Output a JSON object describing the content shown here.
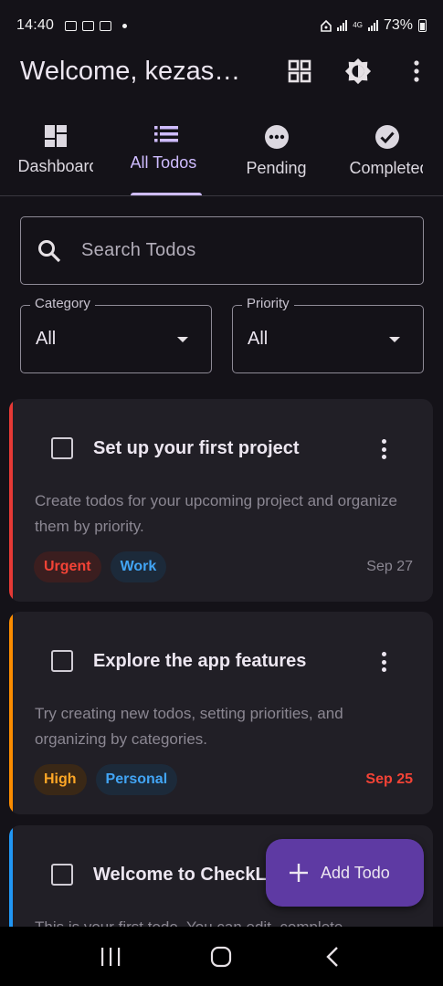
{
  "status_bar": {
    "time": "14:40",
    "network": "4G",
    "battery": "73%"
  },
  "app_bar": {
    "title": "Welcome, kezas…",
    "actions": [
      "grid-view-icon",
      "brightness-icon",
      "more-vert-icon"
    ]
  },
  "tabs": [
    {
      "label": "Dashboard",
      "icon": "dashboard-icon",
      "active": false
    },
    {
      "label": "All Todos",
      "icon": "list-icon",
      "active": true
    },
    {
      "label": "Pending",
      "icon": "pending-icon",
      "active": false
    },
    {
      "label": "Completed",
      "icon": "check-circle-icon",
      "active": false
    }
  ],
  "search": {
    "placeholder": "Search Todos"
  },
  "filters": {
    "category": {
      "label": "Category",
      "value": "All"
    },
    "priority": {
      "label": "Priority",
      "value": "All"
    }
  },
  "todos": [
    {
      "title": "Set up your first project",
      "description": "Create todos for your upcoming project and organize them by priority.",
      "priority": "Urgent",
      "category": "Work",
      "date": "Sep 27",
      "accent": "#e53935",
      "priority_color": "#f44336",
      "priority_bg": "#3b1e1f",
      "category_color": "#42a5f5",
      "category_bg": "#1c2a3a",
      "date_color": "#8b8792",
      "completed": false
    },
    {
      "title": "Explore the app features",
      "description": "Try creating new todos, setting priorities, and organizing by categories.",
      "priority": "High",
      "category": "Personal",
      "date": "Sep 25",
      "accent": "#fb8c00",
      "priority_color": "#ffa726",
      "priority_bg": "#3a2816",
      "category_color": "#42a5f5",
      "category_bg": "#1c2a3a",
      "date_color": "#f44336",
      "completed": false
    },
    {
      "title": "Welcome to CheckList",
      "description": "This is your first todo. You can edit, complete",
      "accent": "#2196f3",
      "completed": false
    }
  ],
  "fab": {
    "label": "Add Todo",
    "color": "#5e3aa3"
  },
  "colors": {
    "background": "#141218",
    "card": "#211f26",
    "primary": "#cfbcff"
  }
}
